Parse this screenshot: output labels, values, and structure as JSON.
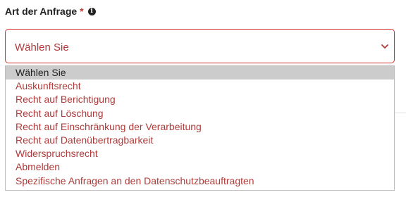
{
  "field": {
    "label": "Art der Anfrage",
    "required_marker": "*",
    "info_icon": "info-circle-icon",
    "value": "Wählen Sie"
  },
  "dropdown": {
    "options": [
      {
        "label": "Wählen Sie",
        "selected": true
      },
      {
        "label": "Auskunftsrecht",
        "selected": false
      },
      {
        "label": "Recht auf Berichtigung",
        "selected": false
      },
      {
        "label": "Recht auf Löschung",
        "selected": false
      },
      {
        "label": "Recht auf Einschränkung der Verarbeitung",
        "selected": false
      },
      {
        "label": "Recht auf Datenübertragbarkeit",
        "selected": false
      },
      {
        "label": "Widerspruchsrecht",
        "selected": false
      },
      {
        "label": "Abmelden",
        "selected": false
      },
      {
        "label": "Spezifische Anfragen an den Datenschutzbeauftragten",
        "selected": false
      }
    ]
  },
  "colors": {
    "error_border": "#d32f2f",
    "option_text": "#b03a3a",
    "highlight_bg": "#cccccc"
  }
}
